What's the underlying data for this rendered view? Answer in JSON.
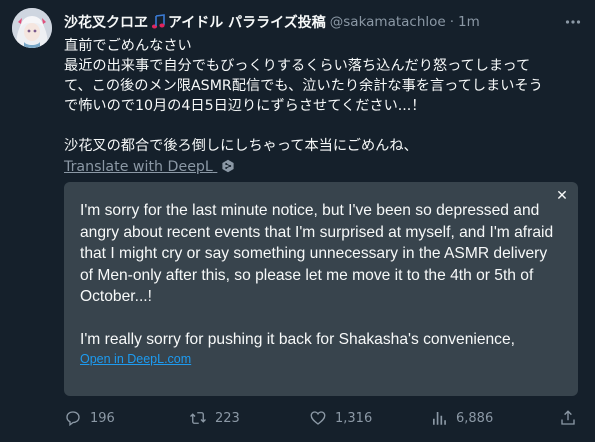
{
  "tweet": {
    "author": {
      "name_part1": "沙花叉クロヱ",
      "name_part2": "アイドル パラライズ投稿",
      "handle": "@sakamatachloe",
      "time": "1m"
    },
    "body_lines": [
      "直前でごめんなさい",
      "最近の出来事で自分でもびっくりするくらい落ち込んだり怒ってしまって",
      "て、この後のメン限ASMR配信でも、泣いたり余計な事を言ってしまいそう",
      "で怖いので10月の4日5日辺りにずらさせてください...！"
    ],
    "body_line_2": "沙花叉の都合で後ろ倒しにしちゃって本当にごめんね、",
    "translate_label": "Translate with DeepL",
    "translation": {
      "paragraph_1": "I'm sorry for the last minute notice, but I've been so depressed and angry about recent events that I'm surprised at myself, and I'm afraid that I might cry or say something unnecessary in the ASMR delivery of Men-only after this, so please let me move it to the 4th or 5th of October...!",
      "paragraph_2": "I'm really sorry for pushing it back for Shakasha's convenience,",
      "open_label": "Open in DeepL.com"
    },
    "stats": {
      "replies": "196",
      "retweets": "223",
      "likes": "1,316",
      "views": "6,886"
    },
    "icons": [
      "more-icon",
      "reply-icon",
      "retweet-icon",
      "like-icon",
      "views-icon",
      "share-icon",
      "close-icon",
      "deepl-icon",
      "music-note-emoji"
    ]
  }
}
